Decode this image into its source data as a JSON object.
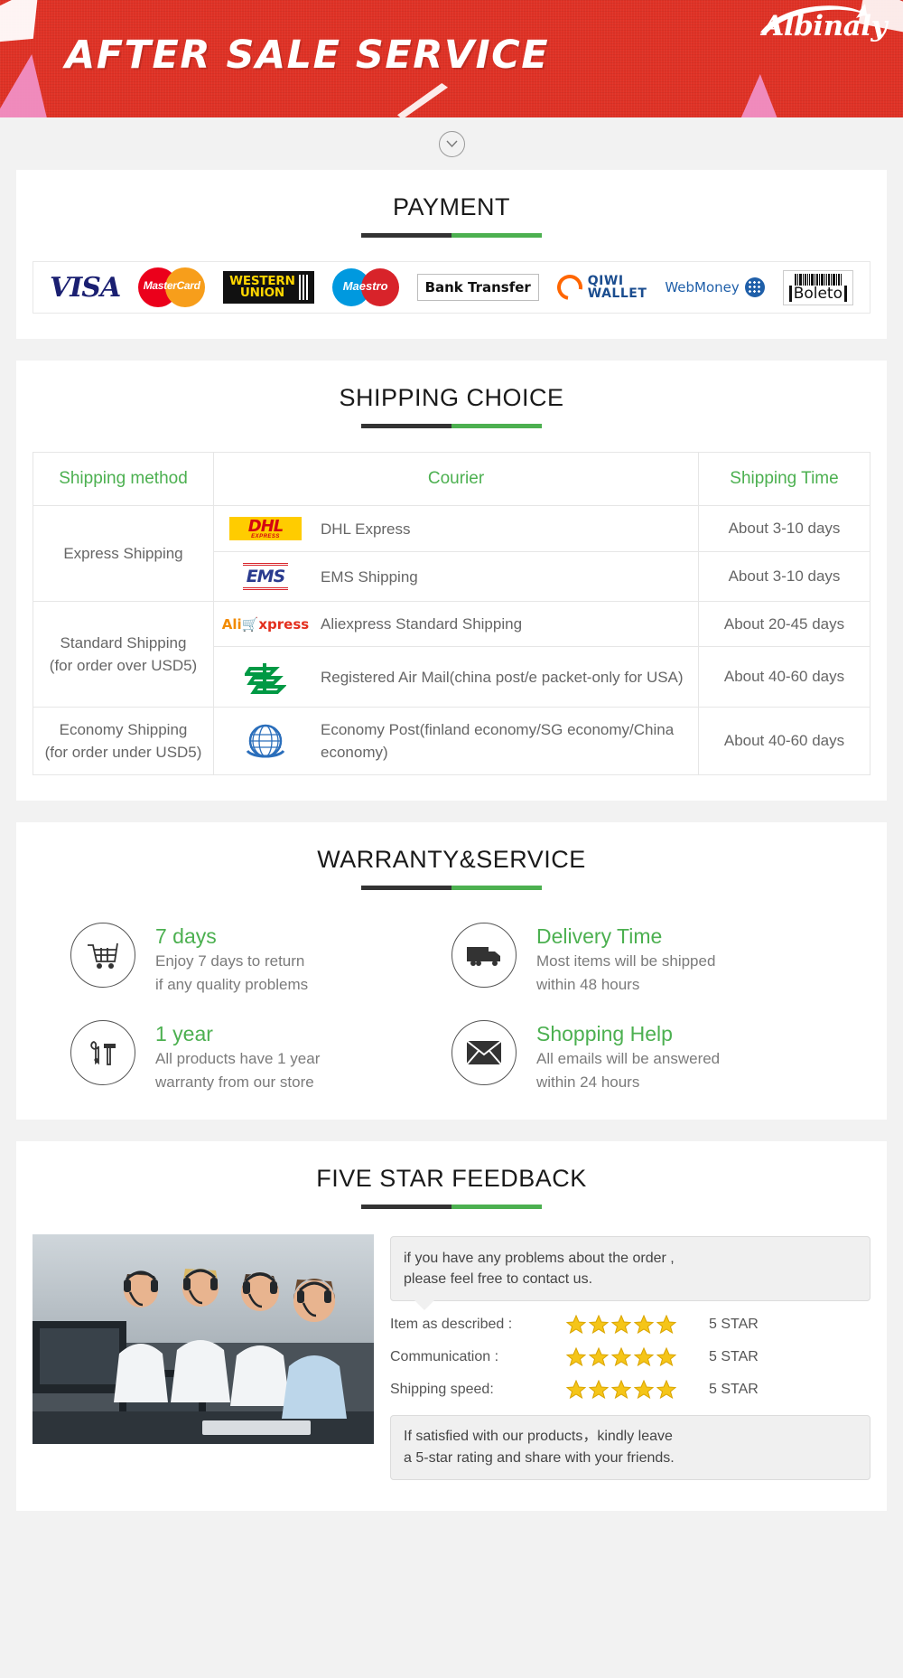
{
  "banner": {
    "title": "AFTER SALE SERVICE",
    "brand": "Albinaly"
  },
  "chevron": {
    "icon": "chevron-down-icon"
  },
  "payment": {
    "title": "PAYMENT",
    "methods": [
      {
        "name": "visa",
        "label": "VISA"
      },
      {
        "name": "mastercard",
        "label": "MasterCard"
      },
      {
        "name": "western-union",
        "line1": "WESTERN",
        "line2": "UNION"
      },
      {
        "name": "maestro",
        "label": "Maestro"
      },
      {
        "name": "bank-transfer",
        "label": "Bank Transfer"
      },
      {
        "name": "qiwi-wallet",
        "line1": "QIWI",
        "line2": "WALLET"
      },
      {
        "name": "webmoney",
        "label": "WebMoney"
      },
      {
        "name": "boleto",
        "label": "Boleto"
      }
    ]
  },
  "shipping": {
    "title": "SHIPPING CHOICE",
    "columns": [
      "Shipping method",
      "Courier",
      "Shipping Time"
    ],
    "rows": [
      {
        "method": "Express Shipping",
        "method_note": "",
        "rowspan": 2,
        "items": [
          {
            "logo": "dhl-logo",
            "courier": "DHL Express",
            "time": "About 3-10 days"
          },
          {
            "logo": "ems-logo",
            "courier": "EMS Shipping",
            "time": "About 3-10 days"
          }
        ]
      },
      {
        "method": "Standard Shipping",
        "method_note": "(for order over USD5)",
        "rowspan": 2,
        "items": [
          {
            "logo": "aliexpress-logo",
            "courier": "Aliexpress Standard Shipping",
            "time": "About 20-45 days"
          },
          {
            "logo": "china-post-logo",
            "courier": "Registered Air Mail(china post/e packet-only for USA)",
            "time": "About 40-60 days"
          }
        ]
      },
      {
        "method": "Economy Shipping",
        "method_note": "(for order under USD5)",
        "rowspan": 1,
        "items": [
          {
            "logo": "un-logo",
            "courier": "Economy Post(finland economy/SG economy/China economy)",
            "time": "About 40-60 days"
          }
        ]
      }
    ]
  },
  "warranty": {
    "title": "WARRANTY&SERVICE",
    "items": [
      {
        "icon": "shopping-cart-icon",
        "title": "7 days",
        "line1": "Enjoy 7 days to return",
        "line2": "if any quality problems"
      },
      {
        "icon": "delivery-truck-icon",
        "title": "Delivery Time",
        "line1": "Most items will be shipped",
        "line2": "within 48 hours"
      },
      {
        "icon": "tools-icon",
        "title": "1 year",
        "line1": "All products have 1 year",
        "line2": "warranty from our store"
      },
      {
        "icon": "envelope-icon",
        "title": "Shopping Help",
        "line1": "All emails will be answered",
        "line2": "within 24 hours"
      }
    ]
  },
  "feedback": {
    "title": "FIVE STAR FEEDBACK",
    "bubble_line1": "if you have any problems about the order ,",
    "bubble_line2": "please feel free to contact us.",
    "ratings": [
      {
        "label": "Item as described :",
        "stars": 5,
        "value": "5 STAR"
      },
      {
        "label": "Communication :",
        "stars": 5,
        "value": "5 STAR"
      },
      {
        "label": "Shipping speed:",
        "stars": 5,
        "value": "5 STAR"
      }
    ],
    "note_line1": "If satisfied with our products，kindly leave",
    "note_line2": "a 5-star rating and share with your friends.",
    "photo_alt": "call-center-agents-photo"
  },
  "colors": {
    "banner_red": "#e03226",
    "accent_green": "#4cb050",
    "rule_dark": "#333333",
    "star_gold": "#f5c518"
  }
}
